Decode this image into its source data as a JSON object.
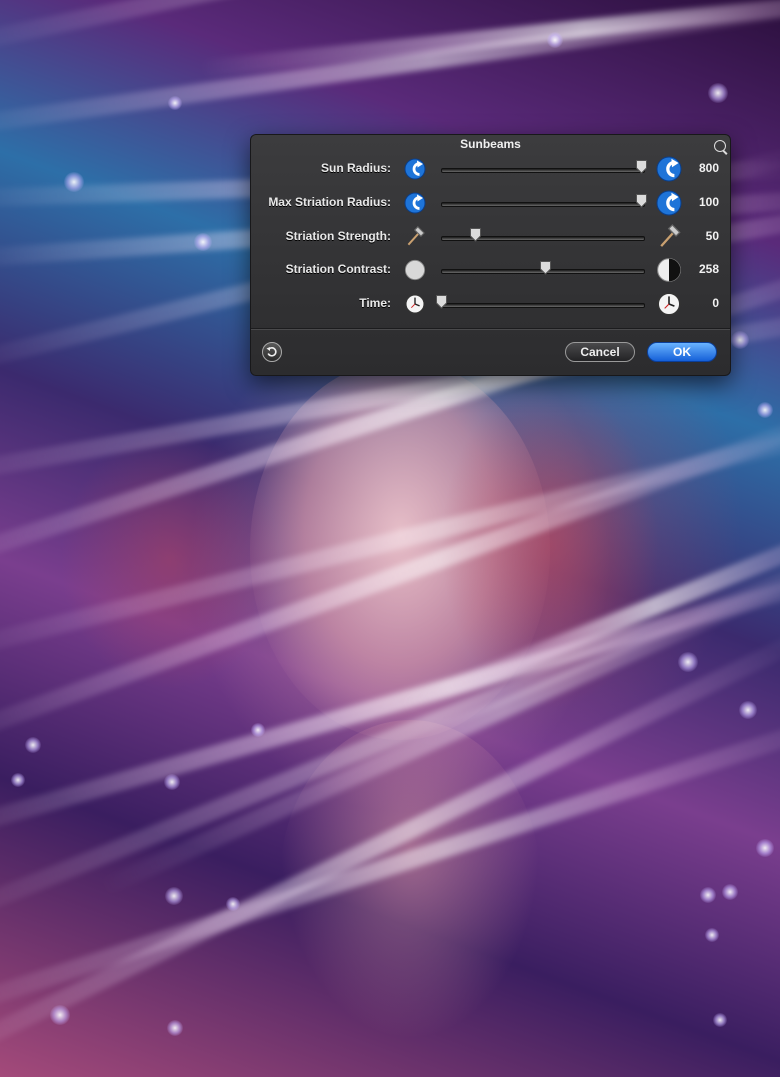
{
  "dialog": {
    "title": "Sunbeams",
    "rows": [
      {
        "label": "Sun Radius:",
        "value": "800",
        "slider": 1.0,
        "icon_min": "sun-radius-small-icon",
        "icon_max": "sun-radius-large-icon"
      },
      {
        "label": "Max Striation Radius:",
        "value": "100",
        "slider": 1.0,
        "icon_min": "striation-radius-small-icon",
        "icon_max": "striation-radius-large-icon"
      },
      {
        "label": "Striation Strength:",
        "value": "50",
        "slider": 0.17,
        "icon_min": "hammer-small-icon",
        "icon_max": "hammer-large-icon"
      },
      {
        "label": "Striation Contrast:",
        "value": "258",
        "slider": 0.52,
        "icon_min": "contrast-low-icon",
        "icon_max": "contrast-high-icon"
      },
      {
        "label": "Time:",
        "value": "0",
        "slider": 0.0,
        "icon_min": "clock-small-icon",
        "icon_max": "clock-large-icon"
      }
    ],
    "buttons": {
      "cancel": "Cancel",
      "ok": "OK"
    }
  },
  "colors": {
    "ok_accent": "#1c6fe6",
    "panel": "#333335",
    "arrow_icon": "#1e74d8"
  }
}
